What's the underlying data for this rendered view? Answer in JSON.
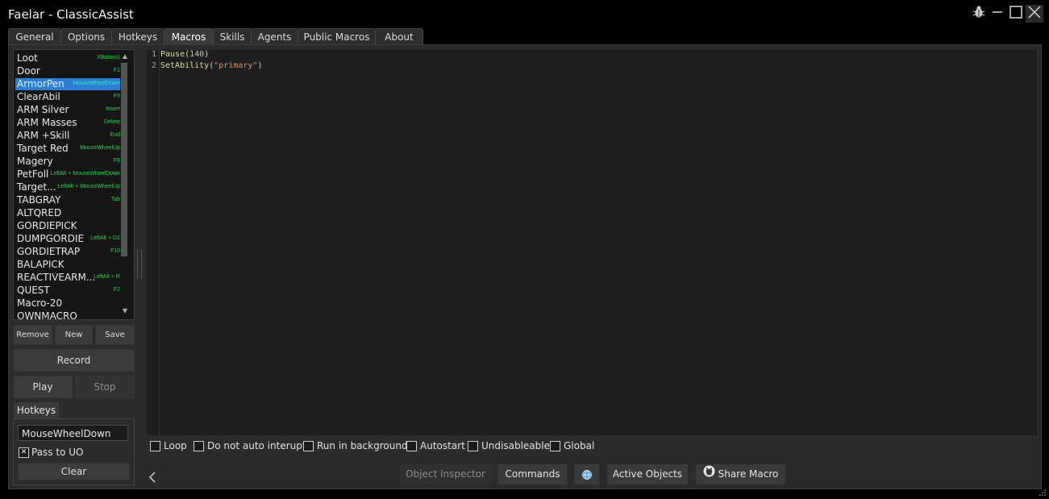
{
  "window": {
    "title": "Faelar - ClassicAssist",
    "controls": [
      "bug-icon",
      "minimize-icon",
      "maximize-icon",
      "close-icon"
    ]
  },
  "tabs": [
    {
      "label": "General"
    },
    {
      "label": "Options"
    },
    {
      "label": "Hotkeys"
    },
    {
      "label": "Macros",
      "active": true
    },
    {
      "label": "Skills"
    },
    {
      "label": "Agents"
    },
    {
      "label": "Public Macros"
    },
    {
      "label": "About"
    }
  ],
  "macros": [
    {
      "name": "Loot",
      "hotkey": "XButton1"
    },
    {
      "name": "Door",
      "hotkey": "F1"
    },
    {
      "name": "ArmorPen",
      "hotkey": "MouseWheelDown",
      "selected": true
    },
    {
      "name": "ClearAbil",
      "hotkey": "F5"
    },
    {
      "name": "ARM Silver",
      "hotkey": "Insert"
    },
    {
      "name": "ARM Masses",
      "hotkey": "Delete"
    },
    {
      "name": "ARM +Skill",
      "hotkey": "End"
    },
    {
      "name": "Target Red",
      "hotkey": "MouseWheelUp"
    },
    {
      "name": "Magery",
      "hotkey": "F8"
    },
    {
      "name": "PetFoll",
      "hotkey": "LeftAlt + MouseWheelDown"
    },
    {
      "name": "Target...",
      "hotkey": "LeftAlt + MouseWheelUp"
    },
    {
      "name": "TABGRAY",
      "hotkey": "Tab"
    },
    {
      "name": "ALTQRED",
      "hotkey": ""
    },
    {
      "name": "GORDIEPICK",
      "hotkey": ""
    },
    {
      "name": "DUMPGORDIE",
      "hotkey": "LeftAlt + D2"
    },
    {
      "name": "GORDIETRAP",
      "hotkey": "F10"
    },
    {
      "name": "BALAPICK",
      "hotkey": ""
    },
    {
      "name": "REACTIVEARM...",
      "hotkey": "LeftAlt + R"
    },
    {
      "name": "QUEST",
      "hotkey": "F2"
    },
    {
      "name": "Macro-20",
      "hotkey": ""
    },
    {
      "name": "OWNMACRO",
      "hotkey": ""
    }
  ],
  "list_buttons": {
    "remove": "Remove",
    "new": "New",
    "save": "Save"
  },
  "record_label": "Record",
  "play_label": "Play",
  "stop_label": "Stop",
  "hotkeys_panel": {
    "title": "Hotkeys",
    "value": "MouseWheelDown",
    "pass_to_uo_label": "Pass to UO",
    "pass_to_uo_checked": true,
    "clear_label": "Clear"
  },
  "editor": {
    "lines": [
      {
        "number": "1",
        "fn": "Pause",
        "arg_num": "140",
        "arg_str": null
      },
      {
        "number": "2",
        "fn": "SetAbility",
        "arg_num": null,
        "arg_str": "\"primary\""
      }
    ]
  },
  "options": [
    {
      "label": "Loop",
      "checked": false
    },
    {
      "label": "Do not auto interupt",
      "checked": false
    },
    {
      "label": "Run in background",
      "checked": false
    },
    {
      "label": "Autostart",
      "checked": false
    },
    {
      "label": "Undisableable",
      "checked": false
    },
    {
      "label": "Global",
      "checked": false
    }
  ],
  "bottom_buttons": {
    "object_inspector": "Object Inspector",
    "commands": "Commands",
    "active_objects": "Active Objects",
    "share_macro": "Share Macro"
  },
  "colors": {
    "background": "#000000",
    "panel": "#2b2b2b",
    "editor": "#1e1e1e",
    "selection": "#2a7fd4",
    "hotkey_text": "#2fd14f"
  }
}
